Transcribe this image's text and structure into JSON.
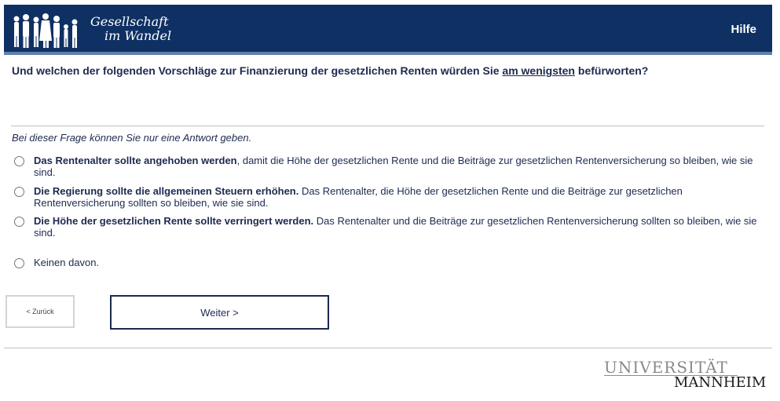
{
  "header": {
    "logo_line1": "Gesellschaft",
    "logo_line2": "im Wandel",
    "help_label": "Hilfe"
  },
  "question": {
    "before": "Und welchen der folgenden Vorschläge zur Finanzierung der gesetzlichen Renten würden Sie ",
    "emphasis": "am wenigsten",
    "after": " befürworten?"
  },
  "instruction": "Bei dieser Frage können Sie nur eine Antwort geben.",
  "options": [
    {
      "bold": "Das Rentenalter sollte angehoben werden",
      "rest": ", damit die Höhe der gesetzlichen Rente und die Beiträge zur gesetzlichen Rentenversicherung so bleiben, wie sie sind."
    },
    {
      "bold": "Die Regierung sollte die allgemeinen Steuern erhöhen.",
      "rest": " Das Rentenalter, die Höhe der gesetzlichen Rente und die Beiträge zur gesetzlichen Rentenversicherung sollten so bleiben, wie sie sind."
    },
    {
      "bold": "Die Höhe der gesetzlichen Rente sollte verringert werden.",
      "rest": " Das Rentenalter und die Beiträge zur gesetzlichen Rentenversicherung sollten so bleiben, wie sie sind."
    },
    {
      "bold": "",
      "rest": "Keinen davon."
    }
  ],
  "nav": {
    "back_label": "< Zurück",
    "next_label": "Weiter >"
  },
  "footer": {
    "uni_line1": "UNIVERSITÄT",
    "uni_line2": "MANNHEIM"
  },
  "colors": {
    "header_bg": "#0f3063",
    "header_stripe": "#5d80b0",
    "text": "#1c2a4f"
  }
}
